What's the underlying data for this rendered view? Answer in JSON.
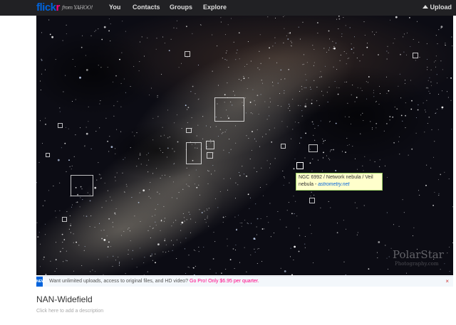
{
  "header": {
    "logo_flick": "flick",
    "logo_r": "r",
    "logo_yahoo": "from YAHOO!",
    "nav": [
      "You",
      "Contacts",
      "Groups",
      "Explore"
    ],
    "upload_label": "Upload"
  },
  "photo": {
    "note_text": "NGC 6992 / Network nebula / Veil nebula - ",
    "note_link": "astrometry.net",
    "watermark": "PolarStar",
    "watermark_sub": "Photography.com"
  },
  "promo": {
    "badge": "NEW",
    "text": "Want unlimited uploads, access to original files, and HD video? ",
    "link": "Go Pro! Only $6.95 per quarter.",
    "close": "×"
  },
  "title": "NAN-Widefield",
  "description_placeholder": "Click here to add a description",
  "colors": {
    "accent_blue": "#0063dc",
    "accent_pink": "#ff0084",
    "topbar": "#212124"
  }
}
